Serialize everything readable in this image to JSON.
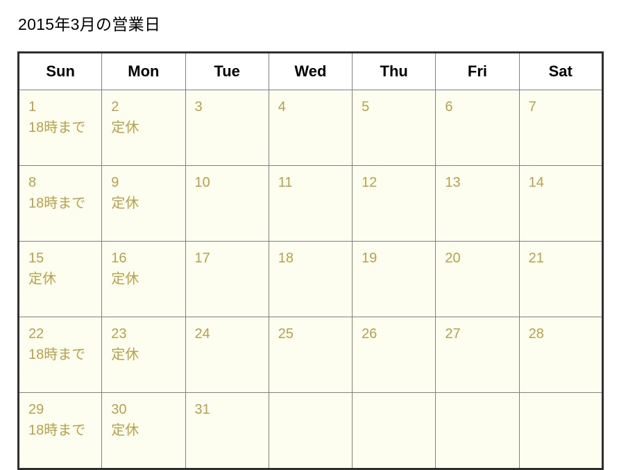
{
  "page": {
    "title": "2015年3月の営業日"
  },
  "colors": {
    "sunday_text": "#1f7ab5",
    "sunday_bg": "#eaf4f9",
    "closed_text": "#cc1f1f",
    "closed_bg": "#fcf0f3",
    "weekday_text": "#b8a14a",
    "weekday_bg": "#fdfdf0",
    "header_text": "#000000",
    "header_bg": "#ffffff",
    "grid_line": "#808080",
    "outer_border": "#2e2e2e"
  },
  "calendar": {
    "year": "2015",
    "month": "3",
    "headers": [
      "Sun",
      "Mon",
      "Tue",
      "Wed",
      "Thu",
      "Fri",
      "Sat"
    ],
    "weeks": [
      [
        {
          "day": "1",
          "note": "18時まで",
          "style": "sun"
        },
        {
          "day": "2",
          "note": "定休",
          "style": "closed"
        },
        {
          "day": "3",
          "note": "",
          "style": "weekday"
        },
        {
          "day": "4",
          "note": "",
          "style": "weekday"
        },
        {
          "day": "5",
          "note": "",
          "style": "weekday"
        },
        {
          "day": "6",
          "note": "",
          "style": "weekday"
        },
        {
          "day": "7",
          "note": "",
          "style": "weekday"
        }
      ],
      [
        {
          "day": "8",
          "note": "18時まで",
          "style": "sun"
        },
        {
          "day": "9",
          "note": "定休",
          "style": "closed"
        },
        {
          "day": "10",
          "note": "",
          "style": "weekday"
        },
        {
          "day": "11",
          "note": "",
          "style": "weekday"
        },
        {
          "day": "12",
          "note": "",
          "style": "weekday"
        },
        {
          "day": "13",
          "note": "",
          "style": "weekday"
        },
        {
          "day": "14",
          "note": "",
          "style": "weekday"
        }
      ],
      [
        {
          "day": "15",
          "note": "定休",
          "style": "closed"
        },
        {
          "day": "16",
          "note": "定休",
          "style": "closed"
        },
        {
          "day": "17",
          "note": "",
          "style": "weekday"
        },
        {
          "day": "18",
          "note": "",
          "style": "weekday"
        },
        {
          "day": "19",
          "note": "",
          "style": "weekday"
        },
        {
          "day": "20",
          "note": "",
          "style": "weekday"
        },
        {
          "day": "21",
          "note": "",
          "style": "weekday"
        }
      ],
      [
        {
          "day": "22",
          "note": "18時まで",
          "style": "sun"
        },
        {
          "day": "23",
          "note": "定休",
          "style": "closed"
        },
        {
          "day": "24",
          "note": "",
          "style": "weekday"
        },
        {
          "day": "25",
          "note": "",
          "style": "weekday"
        },
        {
          "day": "26",
          "note": "",
          "style": "weekday"
        },
        {
          "day": "27",
          "note": "",
          "style": "weekday"
        },
        {
          "day": "28",
          "note": "",
          "style": "weekday"
        }
      ],
      [
        {
          "day": "29",
          "note": "18時まで",
          "style": "sun"
        },
        {
          "day": "30",
          "note": "定休",
          "style": "closed"
        },
        {
          "day": "31",
          "note": "",
          "style": "weekday"
        },
        {
          "day": "",
          "note": "",
          "style": "empty"
        },
        {
          "day": "",
          "note": "",
          "style": "empty"
        },
        {
          "day": "",
          "note": "",
          "style": "empty"
        },
        {
          "day": "",
          "note": "",
          "style": "empty"
        }
      ]
    ]
  }
}
